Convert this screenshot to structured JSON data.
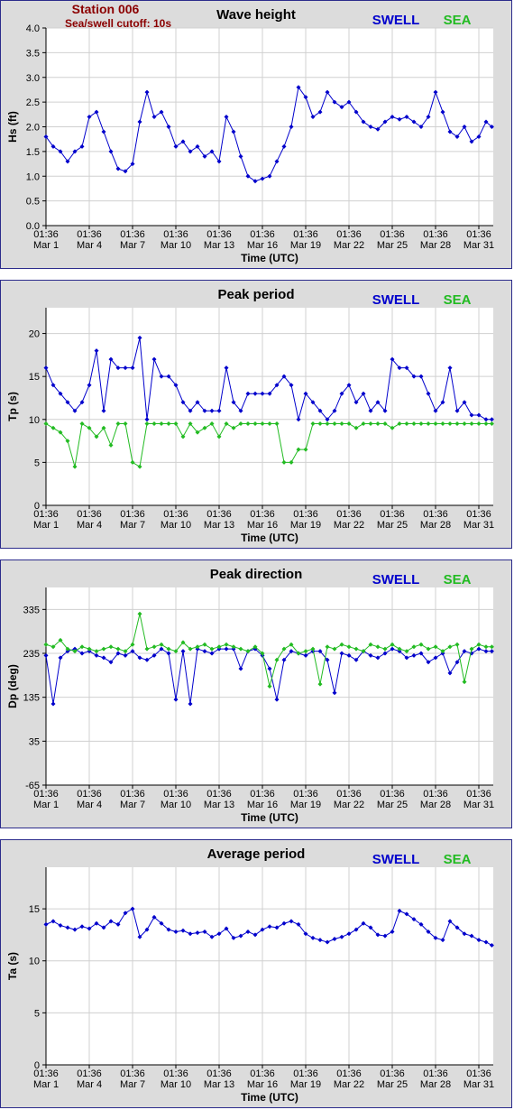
{
  "header": {
    "station": "Station 006",
    "cutoff": "Sea/swell cutoff: 10s"
  },
  "legend": {
    "swell": "SWELL",
    "sea": "SEA",
    "swell_color": "#0000cc",
    "sea_color": "#22bb22"
  },
  "x_ticks": [
    [
      "01:36",
      "Mar 1"
    ],
    [
      "01:36",
      "Mar 4"
    ],
    [
      "01:36",
      "Mar 7"
    ],
    [
      "01:36",
      "Mar 10"
    ],
    [
      "01:36",
      "Mar 13"
    ],
    [
      "01:36",
      "Mar 16"
    ],
    [
      "01:36",
      "Mar 19"
    ],
    [
      "01:36",
      "Mar 22"
    ],
    [
      "01:36",
      "Mar 25"
    ],
    [
      "01:36",
      "Mar 28"
    ],
    [
      "01:36",
      "Mar 31"
    ]
  ],
  "x_label": "Time (UTC)",
  "chart_data": [
    {
      "type": "line",
      "title": "Wave height",
      "ylabel": "Hs (ft)",
      "ylim": [
        0,
        4
      ],
      "yticks": [
        "0.0",
        "0.5",
        "1.0",
        "1.5",
        "2.0",
        "2.5",
        "3.0",
        "3.5",
        "4.0"
      ],
      "grid": true,
      "legend_position": "top-right",
      "x_unit": "days since Mar 1 01:36 UTC",
      "series": [
        {
          "name": "SWELL",
          "color": "#0000cc",
          "x": [
            0,
            0.5,
            1,
            1.5,
            2,
            2.5,
            3,
            3.5,
            4,
            4.5,
            5,
            5.5,
            6,
            6.5,
            7,
            7.5,
            8,
            8.5,
            9,
            9.5,
            10,
            10.5,
            11,
            11.5,
            12,
            12.5,
            13,
            13.5,
            14,
            14.5,
            15,
            15.5,
            16,
            16.5,
            17,
            17.5,
            18,
            18.5,
            19,
            19.5,
            20,
            20.5,
            21,
            21.5,
            22,
            22.5,
            23,
            23.5,
            24,
            24.5,
            25,
            25.5,
            26,
            26.5,
            27,
            27.5,
            28,
            28.5,
            29,
            29.5,
            30,
            30.5,
            30.9
          ],
          "y": [
            1.8,
            1.6,
            1.5,
            1.3,
            1.5,
            1.6,
            2.2,
            2.3,
            1.9,
            1.5,
            1.15,
            1.1,
            1.25,
            2.1,
            2.7,
            2.2,
            2.3,
            2.0,
            1.6,
            1.7,
            1.5,
            1.6,
            1.4,
            1.5,
            1.3,
            2.2,
            1.9,
            1.4,
            1.0,
            0.9,
            0.95,
            1.0,
            1.3,
            1.6,
            2.0,
            2.8,
            2.6,
            2.2,
            2.3,
            2.7,
            2.5,
            2.4,
            2.5,
            2.3,
            2.1,
            2.0,
            1.95,
            2.1,
            2.2,
            2.15,
            2.2,
            2.1,
            2.0,
            2.2,
            2.7,
            2.3,
            1.9,
            1.8,
            2.0,
            1.7,
            1.8,
            2.1,
            2.0
          ]
        }
      ]
    },
    {
      "type": "line",
      "title": "Peak period",
      "ylabel": "Tp (s)",
      "ylim": [
        0,
        23
      ],
      "yticks": [
        "0",
        "5",
        "10",
        "15",
        "20"
      ],
      "grid": true,
      "legend_position": "top-right",
      "series": [
        {
          "name": "SWELL",
          "color": "#0000cc",
          "x": [
            0,
            0.5,
            1,
            1.5,
            2,
            2.5,
            3,
            3.5,
            4,
            4.5,
            5,
            5.5,
            6,
            6.5,
            7,
            7.5,
            8,
            8.5,
            9,
            9.5,
            10,
            10.5,
            11,
            11.5,
            12,
            12.5,
            13,
            13.5,
            14,
            14.5,
            15,
            15.5,
            16,
            16.5,
            17,
            17.5,
            18,
            18.5,
            19,
            19.5,
            20,
            20.5,
            21,
            21.5,
            22,
            22.5,
            23,
            23.5,
            24,
            24.5,
            25,
            25.5,
            26,
            26.5,
            27,
            27.5,
            28,
            28.5,
            29,
            29.5,
            30,
            30.5,
            30.9
          ],
          "y": [
            16,
            14,
            13,
            12,
            11,
            12,
            14,
            18,
            11,
            17,
            16,
            16,
            16,
            19.5,
            10,
            17,
            15,
            15,
            14,
            12,
            11,
            12,
            11,
            11,
            11,
            16,
            12,
            11,
            13,
            13,
            13,
            13,
            14,
            15,
            14,
            10,
            13,
            12,
            11,
            10,
            11,
            13,
            14,
            12,
            13,
            11,
            12,
            11,
            17,
            16,
            16,
            15,
            15,
            13,
            11,
            12,
            16,
            11,
            12,
            10.5,
            10.5,
            10,
            10
          ]
        },
        {
          "name": "SEA",
          "color": "#22bb22",
          "x": [
            0,
            0.5,
            1,
            1.5,
            2,
            2.5,
            3,
            3.5,
            4,
            4.5,
            5,
            5.5,
            6,
            6.5,
            7,
            7.5,
            8,
            8.5,
            9,
            9.5,
            10,
            10.5,
            11,
            11.5,
            12,
            12.5,
            13,
            13.5,
            14,
            14.5,
            15,
            15.5,
            16,
            16.5,
            17,
            17.5,
            18,
            18.5,
            19,
            19.5,
            20,
            20.5,
            21,
            21.5,
            22,
            22.5,
            23,
            23.5,
            24,
            24.5,
            25,
            25.5,
            26,
            26.5,
            27,
            27.5,
            28,
            28.5,
            29,
            29.5,
            30,
            30.5,
            30.9
          ],
          "y": [
            9.5,
            9,
            8.5,
            7.5,
            4.5,
            9.5,
            9,
            8,
            9,
            7,
            9.5,
            9.5,
            5,
            4.5,
            9.5,
            9.5,
            9.5,
            9.5,
            9.5,
            8,
            9.5,
            8.5,
            9,
            9.5,
            8,
            9.5,
            9,
            9.5,
            9.5,
            9.5,
            9.5,
            9.5,
            9.5,
            5,
            5,
            6.5,
            6.5,
            9.5,
            9.5,
            9.5,
            9.5,
            9.5,
            9.5,
            9,
            9.5,
            9.5,
            9.5,
            9.5,
            9,
            9.5,
            9.5,
            9.5,
            9.5,
            9.5,
            9.5,
            9.5,
            9.5,
            9.5,
            9.5,
            9.5,
            9.5,
            9.5,
            9.5
          ]
        }
      ]
    },
    {
      "type": "line",
      "title": "Peak direction",
      "ylabel": "Dp (deg)",
      "ylim": [
        -65,
        385
      ],
      "yticks": [
        "-65",
        "35",
        "135",
        "235",
        "335"
      ],
      "grid": true,
      "legend_position": "top-right",
      "series": [
        {
          "name": "SWELL",
          "color": "#0000cc",
          "x": [
            0,
            0.5,
            1,
            1.5,
            2,
            2.5,
            3,
            3.5,
            4,
            4.5,
            5,
            5.5,
            6,
            6.5,
            7,
            7.5,
            8,
            8.5,
            9,
            9.5,
            10,
            10.5,
            11,
            11.5,
            12,
            12.5,
            13,
            13.5,
            14,
            14.5,
            15,
            15.5,
            16,
            16.5,
            17,
            17.5,
            18,
            18.5,
            19,
            19.5,
            20,
            20.5,
            21,
            21.5,
            22,
            22.5,
            23,
            23.5,
            24,
            24.5,
            25,
            25.5,
            26,
            26.5,
            27,
            27.5,
            28,
            28.5,
            29,
            29.5,
            30,
            30.5,
            30.9
          ],
          "y": [
            230,
            120,
            225,
            240,
            245,
            235,
            240,
            230,
            225,
            215,
            235,
            230,
            240,
            225,
            220,
            230,
            245,
            235,
            130,
            240,
            120,
            245,
            240,
            235,
            245,
            245,
            245,
            200,
            240,
            245,
            230,
            200,
            130,
            220,
            240,
            235,
            230,
            240,
            240,
            220,
            145,
            235,
            230,
            220,
            240,
            230,
            225,
            235,
            245,
            240,
            225,
            230,
            235,
            215,
            225,
            235,
            190,
            215,
            240,
            235,
            245,
            240,
            240
          ]
        },
        {
          "name": "SEA",
          "color": "#22bb22",
          "x": [
            0,
            0.5,
            1,
            1.5,
            2,
            2.5,
            3,
            3.5,
            4,
            4.5,
            5,
            5.5,
            6,
            6.5,
            7,
            7.5,
            8,
            8.5,
            9,
            9.5,
            10,
            10.5,
            11,
            11.5,
            12,
            12.5,
            13,
            13.5,
            14,
            14.5,
            15,
            15.5,
            16,
            16.5,
            17,
            17.5,
            18,
            18.5,
            19,
            19.5,
            20,
            20.5,
            21,
            21.5,
            22,
            22.5,
            23,
            23.5,
            24,
            24.5,
            25,
            25.5,
            26,
            26.5,
            27,
            27.5,
            28,
            28.5,
            29,
            29.5,
            30,
            30.5,
            30.9
          ],
          "y": [
            255,
            250,
            265,
            245,
            240,
            250,
            245,
            240,
            245,
            250,
            245,
            240,
            255,
            325,
            245,
            250,
            255,
            245,
            240,
            260,
            245,
            250,
            255,
            245,
            250,
            255,
            250,
            245,
            240,
            250,
            235,
            160,
            220,
            245,
            255,
            235,
            240,
            245,
            165,
            250,
            245,
            255,
            250,
            245,
            240,
            255,
            250,
            245,
            255,
            245,
            240,
            250,
            255,
            245,
            250,
            240,
            250,
            255,
            170,
            245,
            255,
            250,
            250
          ]
        }
      ]
    },
    {
      "type": "line",
      "title": "Average period",
      "ylabel": "Ta (s)",
      "ylim": [
        0,
        19
      ],
      "yticks": [
        "0",
        "5",
        "10",
        "15"
      ],
      "grid": true,
      "legend_position": "top-right",
      "series": [
        {
          "name": "SWELL",
          "color": "#0000cc",
          "x": [
            0,
            0.5,
            1,
            1.5,
            2,
            2.5,
            3,
            3.5,
            4,
            4.5,
            5,
            5.5,
            6,
            6.5,
            7,
            7.5,
            8,
            8.5,
            9,
            9.5,
            10,
            10.5,
            11,
            11.5,
            12,
            12.5,
            13,
            13.5,
            14,
            14.5,
            15,
            15.5,
            16,
            16.5,
            17,
            17.5,
            18,
            18.5,
            19,
            19.5,
            20,
            20.5,
            21,
            21.5,
            22,
            22.5,
            23,
            23.5,
            24,
            24.5,
            25,
            25.5,
            26,
            26.5,
            27,
            27.5,
            28,
            28.5,
            29,
            29.5,
            30,
            30.5,
            30.9
          ],
          "y": [
            13.5,
            13.8,
            13.4,
            13.2,
            13.0,
            13.3,
            13.1,
            13.6,
            13.2,
            13.8,
            13.5,
            14.6,
            15.0,
            12.3,
            13.0,
            14.2,
            13.6,
            13.0,
            12.8,
            12.9,
            12.6,
            12.7,
            12.8,
            12.3,
            12.6,
            13.1,
            12.2,
            12.4,
            12.8,
            12.5,
            13.0,
            13.3,
            13.2,
            13.6,
            13.8,
            13.5,
            12.6,
            12.2,
            12.0,
            11.8,
            12.1,
            12.3,
            12.6,
            13.0,
            13.6,
            13.2,
            12.5,
            12.4,
            12.8,
            14.8,
            14.5,
            14.0,
            13.5,
            12.8,
            12.2,
            12.0,
            13.8,
            13.2,
            12.6,
            12.4,
            12.0,
            11.8,
            11.5
          ]
        }
      ]
    }
  ]
}
